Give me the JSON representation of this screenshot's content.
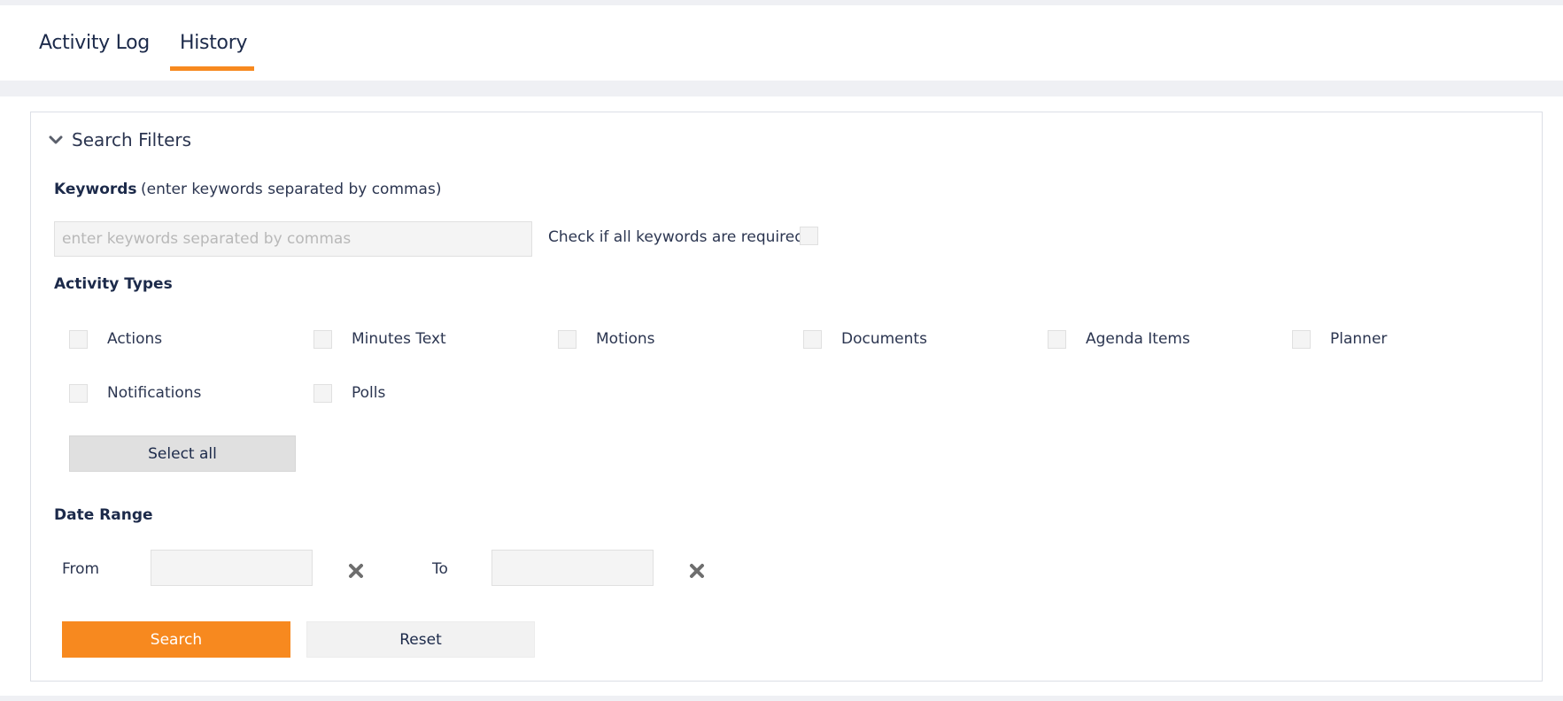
{
  "tabs": [
    {
      "label": "Activity Log",
      "active": false
    },
    {
      "label": "History",
      "active": true
    }
  ],
  "accent_color": "#f7891f",
  "filters": {
    "title": "Search Filters",
    "toggle_icon": "chevron-down-icon",
    "keywords": {
      "label": "Keywords",
      "hint": "(enter keywords separated by commas)",
      "placeholder": "enter keywords separated by commas",
      "value": "",
      "require_all_label": "Check if all keywords are required",
      "require_all_checked": false
    },
    "activity_types": {
      "label": "Activity Types",
      "items": [
        {
          "label": "Actions",
          "checked": false
        },
        {
          "label": "Minutes Text",
          "checked": false
        },
        {
          "label": "Motions",
          "checked": false
        },
        {
          "label": "Documents",
          "checked": false
        },
        {
          "label": "Agenda Items",
          "checked": false
        },
        {
          "label": "Planner",
          "checked": false
        },
        {
          "label": "Notifications",
          "checked": false
        },
        {
          "label": "Polls",
          "checked": false
        }
      ],
      "select_all_label": "Select all"
    },
    "date_range": {
      "label": "Date Range",
      "from_label": "From",
      "from_value": "",
      "to_label": "To",
      "to_value": "",
      "clear_icon": "close-icon"
    },
    "search_label": "Search",
    "reset_label": "Reset"
  }
}
